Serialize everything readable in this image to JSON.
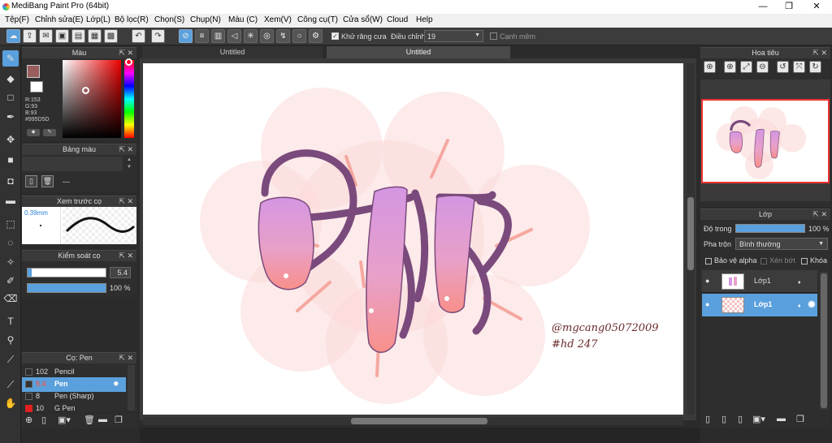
{
  "app": {
    "title": "MediBang Paint Pro (64bit)"
  },
  "window_controls": {
    "minimize": "—",
    "maximize": "❐",
    "close": "✕"
  },
  "menu": [
    "Tệp(F)",
    "Chỉnh sửa(E)",
    "Lớp(L)",
    "Bộ lọc(R)",
    "Chọn(S)",
    "Chụp(N)",
    "Màu (C)",
    "Xem(V)",
    "Công cụ(T)",
    "Cửa sổ(W)",
    "Cloud",
    "Help"
  ],
  "toolbar": {
    "antialias_label": "Khử răng cưa",
    "correction_label": "Điều chỉnh",
    "correction_value": "19",
    "sharp_edges_label": "Cạnh mềm"
  },
  "color_panel": {
    "title": "Màu",
    "r": "R:153",
    "g": "G:93",
    "b": "B:93",
    "hex": "#995D5D",
    "fg_color": "#995d5d",
    "bg_color": "#ffffff"
  },
  "palette_panel": {
    "title": "Bảng màu",
    "dash": "---"
  },
  "brush_preview": {
    "title": "Xem trước cọ",
    "size": "0.39mm"
  },
  "brush_control": {
    "title": "Kiểm soát cọ",
    "size_value": "5.4",
    "opacity_value": "100 %",
    "opacity_fraction": 1.0,
    "size_fraction": 0.05
  },
  "brush_panel": {
    "title": "Cọ: Pen",
    "items": [
      {
        "size": "102",
        "name": "Pencil",
        "color": "#333333"
      },
      {
        "size": "5.4",
        "name": "Pen",
        "color": "#333333",
        "selected": true
      },
      {
        "size": "8",
        "name": "Pen (Sharp)",
        "color": "#333333"
      },
      {
        "size": "10",
        "name": "G Pen",
        "color": "#e02020"
      }
    ]
  },
  "tabs": [
    "Untitled",
    "Untitled"
  ],
  "canvas": {
    "signature_line1": "@mgcang05072009",
    "signature_line2": "#hd 247"
  },
  "navigator": {
    "title": "Hoa tiêu"
  },
  "layer_panel": {
    "title": "Lớp",
    "opacity_label": "Độ trong",
    "opacity_value": "100 %",
    "blend_label": "Pha trộn",
    "blend_value": "Bình thường",
    "protect_alpha": "Bảo vệ alpha",
    "clipping": "Xén bớt",
    "lock": "Khóa",
    "layers": [
      {
        "name": "Lớp1",
        "selected": false
      },
      {
        "name": "Lớp1",
        "selected": true
      }
    ]
  }
}
